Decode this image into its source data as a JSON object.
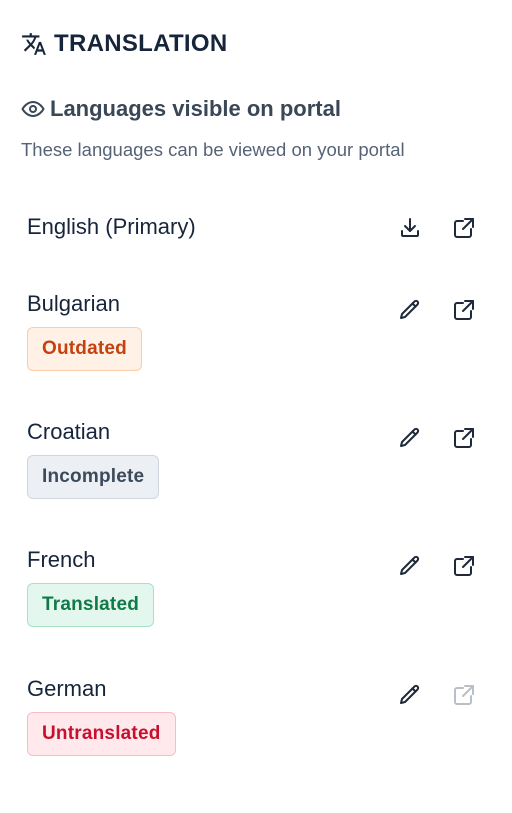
{
  "header": {
    "title": "TRANSLATION",
    "icon": "translate-icon"
  },
  "section": {
    "title": "Languages visible on portal",
    "icon": "eye-icon",
    "description": "These languages can be viewed on your portal"
  },
  "languages": [
    {
      "name": "English (Primary)",
      "status": "",
      "actions": [
        "download-icon",
        "external-link-icon"
      ],
      "external_link_enabled": true
    },
    {
      "name": "Bulgarian",
      "status": "Outdated",
      "actions": [
        "pencil-icon",
        "external-link-icon"
      ],
      "external_link_enabled": true
    },
    {
      "name": "Croatian",
      "status": "Incomplete",
      "actions": [
        "pencil-icon",
        "external-link-icon"
      ],
      "external_link_enabled": true
    },
    {
      "name": "French",
      "status": "Translated",
      "actions": [
        "pencil-icon",
        "external-link-icon"
      ],
      "external_link_enabled": true
    },
    {
      "name": "German",
      "status": "Untranslated",
      "actions": [
        "pencil-icon",
        "external-link-icon"
      ],
      "external_link_enabled": false
    }
  ],
  "colors": {
    "outdated": "#c4420f",
    "incomplete": "#3d4a5c",
    "translated": "#117a47",
    "untranslated": "#c8102e",
    "icon": "#1e2a3a",
    "icon_disabled": "#b9bfc7"
  }
}
